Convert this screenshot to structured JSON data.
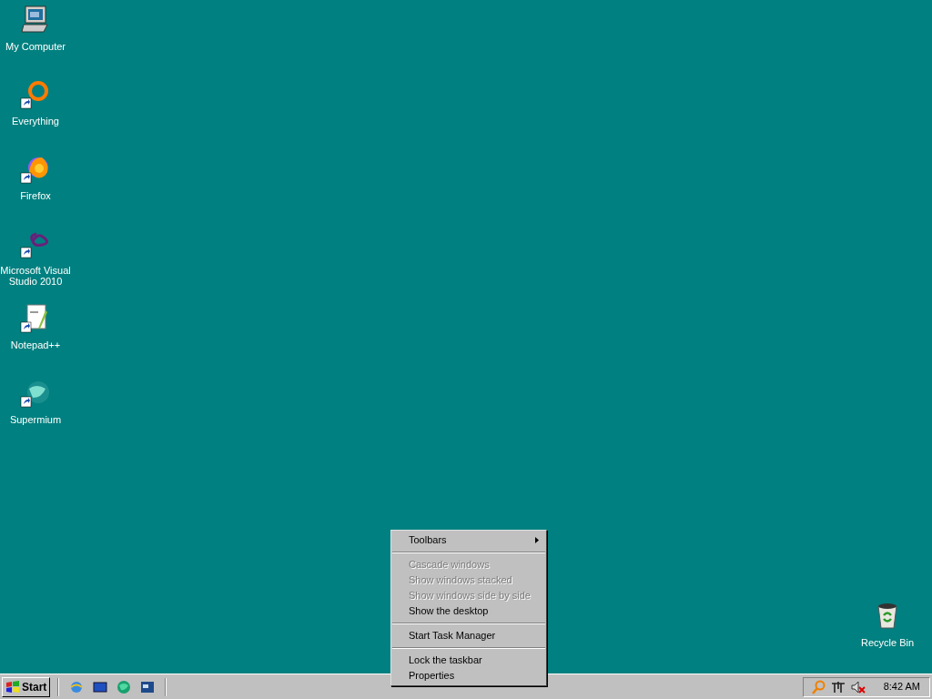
{
  "desktop_icons": [
    {
      "label": "My Computer",
      "kind": "computer",
      "shortcut": false
    },
    {
      "label": "Everything",
      "kind": "ring",
      "shortcut": true
    },
    {
      "label": "Firefox",
      "kind": "fox",
      "shortcut": true
    },
    {
      "label": "Microsoft Visual Studio 2010",
      "kind": "infinity",
      "shortcut": true
    },
    {
      "label": "Notepad++",
      "kind": "notepad",
      "shortcut": true
    },
    {
      "label": "Supermium",
      "kind": "globe",
      "shortcut": true
    }
  ],
  "recycle_bin": {
    "label": "Recycle Bin"
  },
  "context_menu": {
    "items": [
      {
        "kind": "item",
        "label": "Toolbars",
        "disabled": false,
        "submenu": true
      },
      {
        "kind": "separator"
      },
      {
        "kind": "item",
        "label": "Cascade windows",
        "disabled": true,
        "submenu": false
      },
      {
        "kind": "item",
        "label": "Show windows stacked",
        "disabled": true,
        "submenu": false
      },
      {
        "kind": "item",
        "label": "Show windows side by side",
        "disabled": true,
        "submenu": false
      },
      {
        "kind": "item",
        "label": "Show the desktop",
        "disabled": false,
        "submenu": false
      },
      {
        "kind": "separator"
      },
      {
        "kind": "item",
        "label": "Start Task Manager",
        "disabled": false,
        "submenu": false
      },
      {
        "kind": "separator"
      },
      {
        "kind": "item",
        "label": "Lock the taskbar",
        "disabled": false,
        "submenu": false
      },
      {
        "kind": "item",
        "label": "Properties",
        "disabled": false,
        "submenu": false
      }
    ]
  },
  "taskbar": {
    "start_label": "Start",
    "clock": "8:42 AM"
  }
}
